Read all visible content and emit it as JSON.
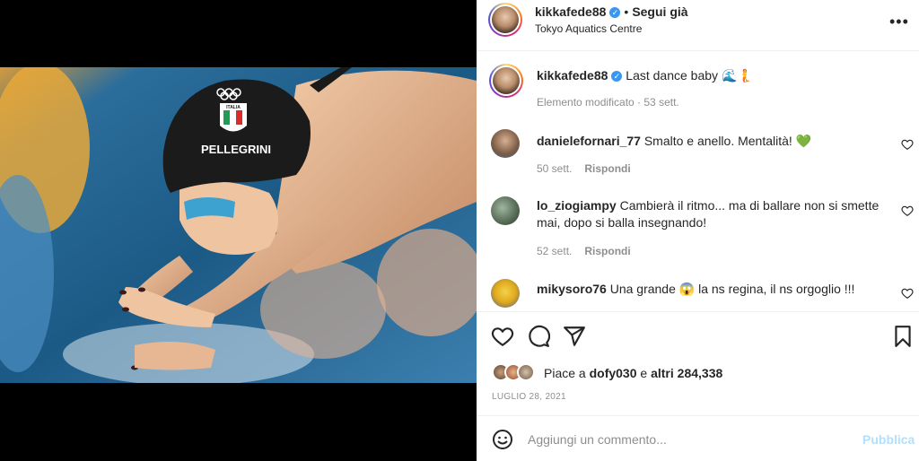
{
  "post": {
    "author": "kikkafede88",
    "follow_status": "Segui già",
    "location": "Tokyo Aquatics Centre",
    "caption": "Last dance baby",
    "caption_emoji": "🌊🧜",
    "edited_label": "Elemento modificato · 53 sett.",
    "cap_text": "PELLEGRINI",
    "cap_flag_text": "ITALIA"
  },
  "comments": [
    {
      "user": "danieleforнari_77",
      "text": "Smalto e anello. Mentalità!",
      "emoji": "💚",
      "age": "50 sett.",
      "reply": "Rispondi"
    },
    {
      "user": "lo_ziogiampy",
      "text": "Cambierà il ritmo... ma di ballare non si smette mai, dopo si balla insegnando!",
      "age": "52 sett.",
      "reply": "Rispondi"
    },
    {
      "user": "mikysoro76",
      "text_before": "Una grande",
      "emoji": "😱",
      "text_after": "la ns regina, il ns orgoglio !!!"
    }
  ],
  "likes": {
    "prefix": "Piace a",
    "user": "dofy030",
    "joiner": "e",
    "others": "altri 284,338"
  },
  "date": "LUGLIO 28, 2021",
  "add_comment": {
    "placeholder": "Aggiungi un commento...",
    "publish": "Pubblica"
  },
  "icons": {
    "more": "more-options-icon",
    "like": "heart-icon",
    "comment": "comment-icon",
    "share": "share-icon",
    "save": "bookmark-icon",
    "emoji": "emoji-icon"
  },
  "colors": {
    "verified": "#3897f0",
    "muted": "#8e8e8e",
    "publish_disabled": "#b2dffc",
    "heart_emoji": "#3cb043"
  }
}
